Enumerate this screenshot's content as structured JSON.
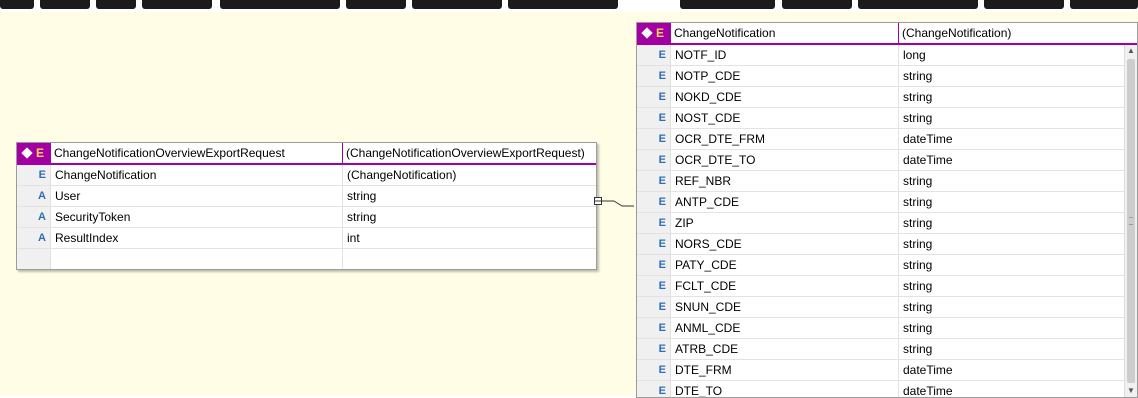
{
  "left_entity": {
    "name": "ChangeNotificationOverviewExportRequest",
    "type": "(ChangeNotificationOverviewExportRequest)",
    "header_kind": "E",
    "rows": [
      {
        "kind": "E",
        "name": "ChangeNotification",
        "type": "(ChangeNotification)"
      },
      {
        "kind": "A",
        "name": "User",
        "type": "string"
      },
      {
        "kind": "A",
        "name": "SecurityToken",
        "type": "string"
      },
      {
        "kind": "A",
        "name": "ResultIndex",
        "type": "int"
      },
      {
        "kind": "",
        "name": "",
        "type": ""
      }
    ]
  },
  "right_entity": {
    "name": "ChangeNotification",
    "type": "(ChangeNotification)",
    "header_kind": "E",
    "rows": [
      {
        "kind": "E",
        "name": "NOTF_ID",
        "type": "long"
      },
      {
        "kind": "E",
        "name": "NOTP_CDE",
        "type": "string"
      },
      {
        "kind": "E",
        "name": "NOKD_CDE",
        "type": "string"
      },
      {
        "kind": "E",
        "name": "NOST_CDE",
        "type": "string"
      },
      {
        "kind": "E",
        "name": "OCR_DTE_FRM",
        "type": "dateTime"
      },
      {
        "kind": "E",
        "name": "OCR_DTE_TO",
        "type": "dateTime"
      },
      {
        "kind": "E",
        "name": "REF_NBR",
        "type": "string"
      },
      {
        "kind": "E",
        "name": "ANTP_CDE",
        "type": "string"
      },
      {
        "kind": "E",
        "name": "ZIP",
        "type": "string"
      },
      {
        "kind": "E",
        "name": "NORS_CDE",
        "type": "string"
      },
      {
        "kind": "E",
        "name": "PATY_CDE",
        "type": "string"
      },
      {
        "kind": "E",
        "name": "FCLT_CDE",
        "type": "string"
      },
      {
        "kind": "E",
        "name": "SNUN_CDE",
        "type": "string"
      },
      {
        "kind": "E",
        "name": "ANML_CDE",
        "type": "string"
      },
      {
        "kind": "E",
        "name": "ATRB_CDE",
        "type": "string"
      },
      {
        "kind": "E",
        "name": "DTE_FRM",
        "type": "dateTime"
      },
      {
        "kind": "E",
        "name": "DTE_TO",
        "type": "dateTime"
      }
    ]
  },
  "colors": {
    "canvas_bg": "#fffde6",
    "header_accent": "#a300a3",
    "element_icon": "#2e6eb7",
    "header_icon": "#ffd85a"
  },
  "icons": {
    "header_marker": "diamond-icon",
    "connector": "relationship-connector-icon"
  }
}
